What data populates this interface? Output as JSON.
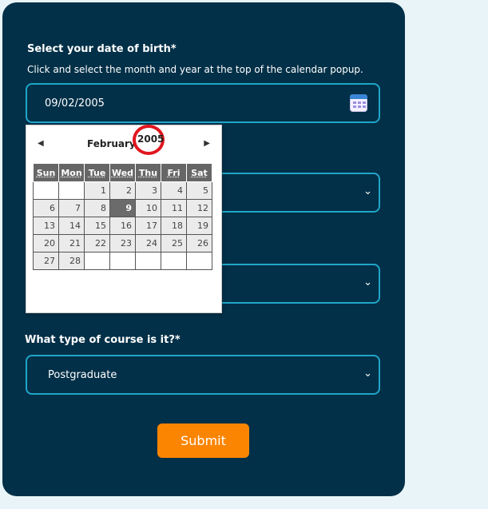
{
  "form": {
    "dob_label": "Select your date of birth*",
    "dob_help": "Click and select the month and year at the top of the calendar popup.",
    "dob_value": "09/02/2005",
    "course_type_label": "What type of course is it?*",
    "course_type_value": "Postgraduate",
    "submit_label": "Submit"
  },
  "calendar": {
    "month": "February",
    "year": "2005",
    "weekdays": [
      "Sun",
      "Mon",
      "Tue",
      "Wed",
      "Thu",
      "Fri",
      "Sat"
    ],
    "weeks": [
      [
        "",
        "",
        "1",
        "2",
        "3",
        "4",
        "5"
      ],
      [
        "6",
        "7",
        "8",
        "9",
        "10",
        "11",
        "12"
      ],
      [
        "13",
        "14",
        "15",
        "16",
        "17",
        "18",
        "19"
      ],
      [
        "20",
        "21",
        "22",
        "23",
        "24",
        "25",
        "26"
      ],
      [
        "27",
        "28",
        "",
        "",
        "",
        "",
        ""
      ]
    ],
    "selected_day": "9"
  },
  "icons": {
    "prev": "chevron-left-icon",
    "next": "chevron-right-icon",
    "calendar": "calendar-icon",
    "select": "chevron-down-icon"
  },
  "colors": {
    "card_bg": "#023048",
    "field_border": "#1fa6c9",
    "submit_bg": "#fb8500",
    "highlight_ring": "#e0161e"
  }
}
